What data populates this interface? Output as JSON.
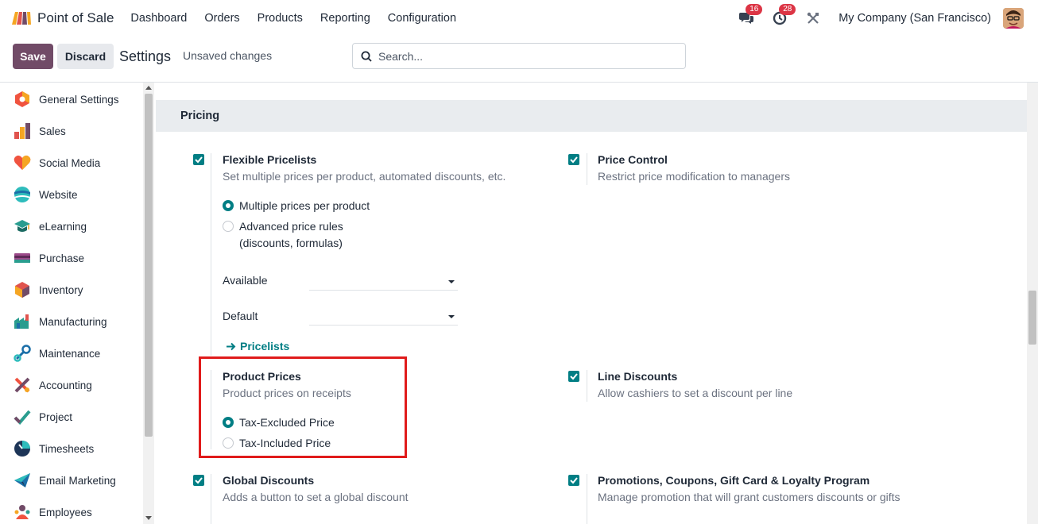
{
  "navbar": {
    "app_name": "Point of Sale",
    "menu": [
      "Dashboard",
      "Orders",
      "Products",
      "Reporting",
      "Configuration"
    ],
    "messages_count": "16",
    "activities_count": "28",
    "company": "My Company (San Francisco)"
  },
  "control": {
    "save_label": "Save",
    "discard_label": "Discard",
    "title": "Settings",
    "status": "Unsaved changes",
    "search_placeholder": "Search..."
  },
  "sidebar": {
    "items": [
      {
        "label": "General Settings",
        "icon": "general-settings-icon"
      },
      {
        "label": "Sales",
        "icon": "sales-icon"
      },
      {
        "label": "Social Media",
        "icon": "social-media-icon"
      },
      {
        "label": "Website",
        "icon": "website-icon"
      },
      {
        "label": "eLearning",
        "icon": "elearning-icon"
      },
      {
        "label": "Purchase",
        "icon": "purchase-icon"
      },
      {
        "label": "Inventory",
        "icon": "inventory-icon"
      },
      {
        "label": "Manufacturing",
        "icon": "manufacturing-icon"
      },
      {
        "label": "Maintenance",
        "icon": "maintenance-icon"
      },
      {
        "label": "Accounting",
        "icon": "accounting-icon"
      },
      {
        "label": "Project",
        "icon": "project-icon"
      },
      {
        "label": "Timesheets",
        "icon": "timesheets-icon"
      },
      {
        "label": "Email Marketing",
        "icon": "email-marketing-icon"
      },
      {
        "label": "Employees",
        "icon": "employees-icon"
      }
    ]
  },
  "pricing": {
    "section_title": "Pricing",
    "flexible_pricelists": {
      "title": "Flexible Pricelists",
      "desc": "Set multiple prices per product, automated discounts, etc.",
      "option_multiple": "Multiple prices per product",
      "option_advanced_1": "Advanced price rules",
      "option_advanced_2": "(discounts, formulas)",
      "available_label": "Available",
      "default_label": "Default",
      "pricelists_link": "Pricelists"
    },
    "price_control": {
      "title": "Price Control",
      "desc": "Restrict price modification to managers"
    },
    "product_prices": {
      "title": "Product Prices",
      "desc": "Product prices on receipts",
      "option_excluded": "Tax-Excluded Price",
      "option_included": "Tax-Included Price"
    },
    "line_discounts": {
      "title": "Line Discounts",
      "desc": "Allow cashiers to set a discount per line"
    },
    "global_discounts": {
      "title": "Global Discounts",
      "desc": "Adds a button to set a global discount"
    },
    "promotions": {
      "title": "Promotions, Coupons, Gift Card & Loyalty Program",
      "desc": "Manage promotion that will grant customers discounts or gifts"
    }
  },
  "colors": {
    "primary": "#714b67",
    "accent": "#017e84",
    "highlight": "#e01b1b"
  }
}
